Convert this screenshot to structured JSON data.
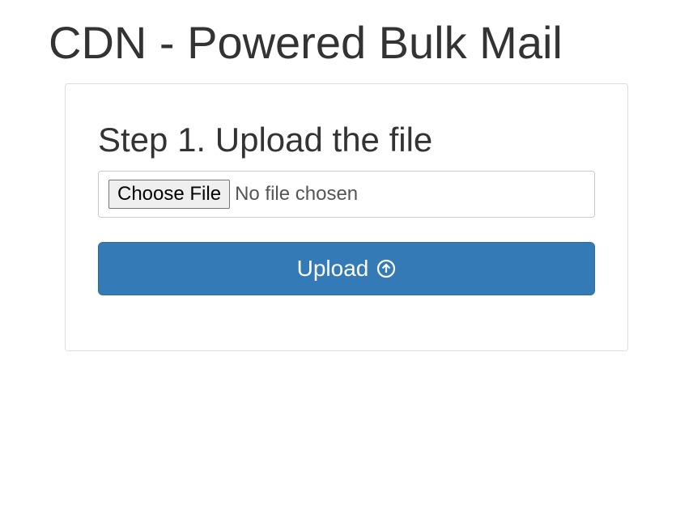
{
  "page": {
    "title": "CDN - Powered Bulk Mail"
  },
  "panel": {
    "heading": "Step 1. Upload the file",
    "file_input": {
      "button_label": "Choose File",
      "status_text": "No file chosen"
    },
    "upload_button_label": "Upload"
  }
}
